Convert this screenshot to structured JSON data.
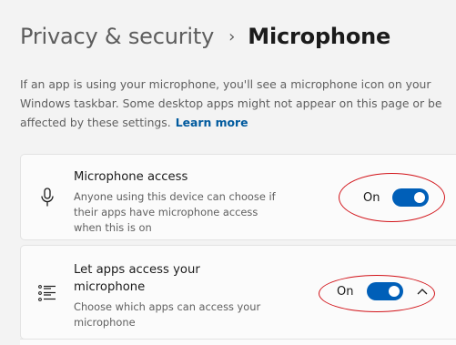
{
  "breadcrumb": {
    "parent": "Privacy & security",
    "separator": "›",
    "current": "Microphone"
  },
  "description": {
    "text": "If an app is using your microphone, you'll see a microphone icon on your Windows taskbar. Some desktop apps might not appear on this page or be affected by these settings.",
    "link": "Learn more"
  },
  "settings": [
    {
      "icon": "microphone-icon",
      "title": "Microphone access",
      "subtitle": "Anyone using this device can choose if their apps have microphone access when this is on",
      "state_label": "On",
      "enabled": true
    },
    {
      "icon": "app-list-icon",
      "title": "Let apps access your microphone",
      "subtitle": "Choose which apps can access your microphone",
      "state_label": "On",
      "enabled": true,
      "expand_icon": "chevron-up-icon"
    }
  ],
  "colors": {
    "accent": "#005fb8",
    "link": "#005a9e",
    "annotation": "#d2141a",
    "background": "#f3f3f3",
    "card": "#fbfbfb"
  }
}
